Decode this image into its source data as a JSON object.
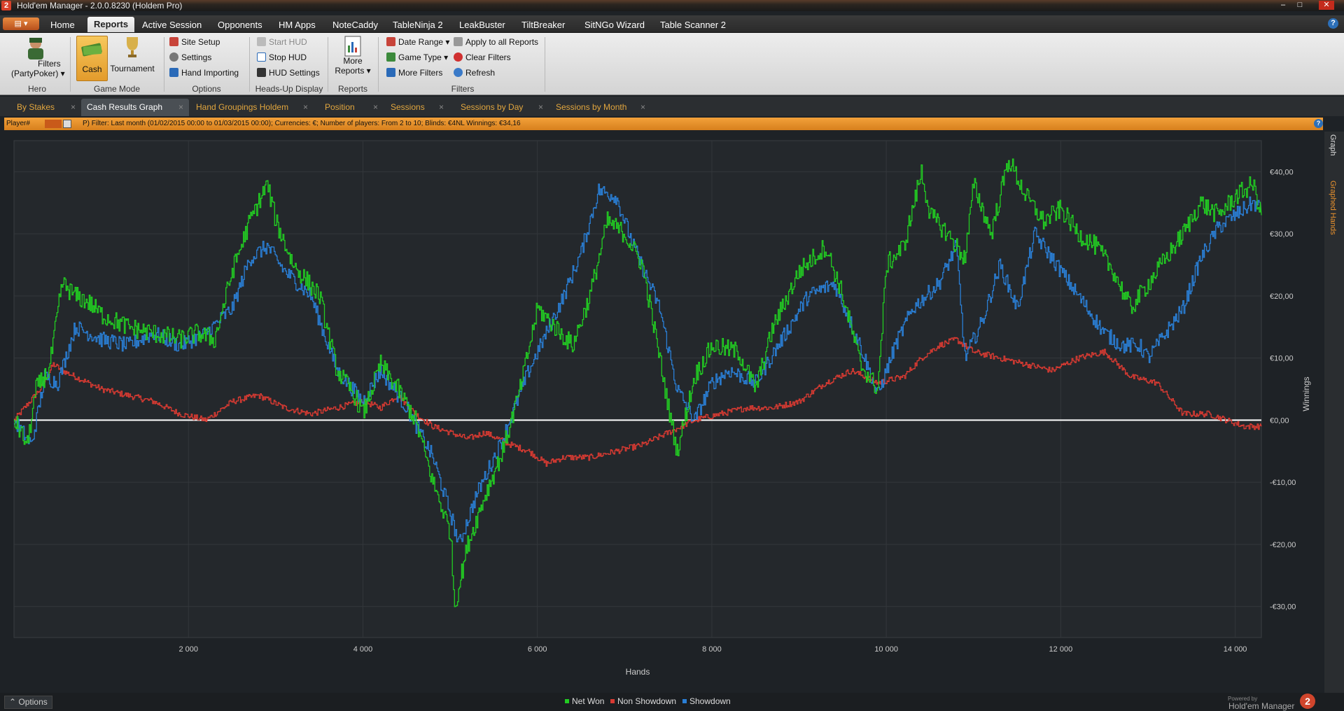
{
  "window": {
    "title": "Hold'em Manager - 2.0.0.8230 (Holdem Pro)",
    "app_badge": "2",
    "controls": [
      "–",
      "□",
      "✕"
    ]
  },
  "menu": {
    "items": [
      "Home",
      "Reports",
      "Active Session",
      "Opponents",
      "HM Apps",
      "NoteCaddy",
      "TableNinja 2",
      "LeakBuster",
      "TiltBreaker",
      "SitNGo Wizard",
      "Table Scanner 2"
    ],
    "active": "Reports",
    "help": "?"
  },
  "ribbon": {
    "hero": {
      "filters_label": "Filters",
      "site_label": "(PartyPoker) ▾",
      "group": "Hero"
    },
    "game_mode": {
      "cash": "Cash",
      "tournament": "Tournament",
      "group": "Game Mode"
    },
    "options": {
      "site_setup": "Site Setup",
      "settings": "Settings",
      "hand_importing": "Hand Importing",
      "group": "Options"
    },
    "hud": {
      "start": "Start HUD",
      "stop": "Stop HUD",
      "settings": "HUD Settings",
      "group": "Heads-Up Display"
    },
    "reports": {
      "more_line1": "More",
      "more_line2": "Reports ▾",
      "group": "Reports"
    },
    "filters": {
      "date_range": "Date Range ▾",
      "game_type": "Game Type ▾",
      "more_filters": "More Filters",
      "apply_all": "Apply to all Reports",
      "clear": "Clear Filters",
      "refresh": "Refresh",
      "group": "Filters"
    }
  },
  "tabs": [
    {
      "label": "By Stakes",
      "active": false
    },
    {
      "label": "Cash Results Graph",
      "active": true
    },
    {
      "label": "Hand Groupings Holdem",
      "active": false
    },
    {
      "label": "Position",
      "active": false
    },
    {
      "label": "Sessions",
      "active": false
    },
    {
      "label": "Sessions by Day",
      "active": false
    },
    {
      "label": "Sessions by Month",
      "active": false
    }
  ],
  "tab_close": "×",
  "filterbar": {
    "player_label": "Player#",
    "text": "P) Filter:  Last month (01/02/2015 00:00 to 01/03/2015 00:00); Currencies: €; Number of players: From 2 to 10; Blinds: €4NL  Winnings:  €34,16",
    "help": "?"
  },
  "side_tabs": {
    "graph": "Graph",
    "graphed_hands": "Graphed Hands"
  },
  "bottom": {
    "options": "Options",
    "powered_by": "Powered by",
    "brand": "Hold'em Manager",
    "brand_badge": "2"
  },
  "colors": {
    "net_won": "#22cc22",
    "non_showdown": "#d83a32",
    "showdown": "#2a7fd6",
    "accent": "#e8912e"
  },
  "chart_data": {
    "type": "line",
    "xlabel": "Hands",
    "ylabel": "Winnings",
    "x_ticks": [
      2000,
      4000,
      6000,
      8000,
      10000,
      12000,
      14000
    ],
    "x_tick_labels": [
      "2 000",
      "4 000",
      "6 000",
      "8 000",
      "10 000",
      "12 000",
      "14 000"
    ],
    "y_ticks": [
      -30,
      -20,
      -10,
      0,
      10,
      20,
      30,
      40
    ],
    "y_tick_labels": [
      "-€30,00",
      "-€20,00",
      "-€10,00",
      "€0,00",
      "€10,00",
      "€20,00",
      "€30,00",
      "€40,00"
    ],
    "xlim": [
      0,
      14300
    ],
    "ylim": [
      -35,
      45
    ],
    "grid": true,
    "legend": "bottom-center",
    "series": [
      {
        "name": "Net Won",
        "x": [
          0,
          150,
          250,
          400,
          550,
          700,
          850,
          1000,
          1300,
          1600,
          1900,
          2100,
          2300,
          2500,
          2700,
          2900,
          3000,
          3200,
          3500,
          3700,
          3900,
          4000,
          4200,
          4400,
          4600,
          4800,
          5000,
          5050,
          5200,
          5400,
          5600,
          5800,
          6000,
          6200,
          6400,
          6600,
          6800,
          7000,
          7200,
          7400,
          7500,
          7600,
          7800,
          8000,
          8300,
          8500,
          8700,
          9000,
          9300,
          9500,
          9700,
          9900,
          10000,
          10200,
          10400,
          10500,
          10700,
          10900,
          11000,
          11200,
          11400,
          11600,
          11800,
          12000,
          12200,
          12400,
          12600,
          12800,
          13000,
          13200,
          13400,
          13600,
          13800,
          14000,
          14200,
          14300
        ],
        "y": [
          0,
          -4,
          5,
          8,
          22,
          20,
          19,
          17,
          15,
          14,
          13,
          14,
          13,
          24,
          32,
          38,
          32,
          25,
          20,
          8,
          4,
          1,
          9,
          5,
          0,
          -10,
          -18,
          -30,
          -20,
          -12,
          -5,
          5,
          18,
          15,
          12,
          20,
          32,
          30,
          25,
          10,
          2,
          -5,
          7,
          12,
          11,
          5,
          15,
          24,
          28,
          20,
          9,
          5,
          25,
          28,
          40,
          33,
          30,
          26,
          38,
          30,
          42,
          36,
          32,
          34,
          30,
          28,
          24,
          18,
          22,
          26,
          30,
          35,
          33,
          36,
          38,
          33
        ]
      },
      {
        "name": "Non Showdown",
        "x": [
          0,
          300,
          450,
          550,
          700,
          1000,
          1300,
          1600,
          1900,
          2200,
          2500,
          2800,
          3100,
          3400,
          3700,
          4000,
          4200,
          4400,
          4600,
          4800,
          5000,
          5200,
          5400,
          5700,
          5900,
          6100,
          6300,
          6600,
          6900,
          7200,
          7500,
          7800,
          8100,
          8400,
          8700,
          9000,
          9300,
          9600,
          9900,
          10200,
          10400,
          10600,
          10800,
          11000,
          11300,
          11600,
          11900,
          12200,
          12500,
          12800,
          13100,
          13400,
          13700,
          13900,
          14100,
          14300
        ],
        "y": [
          0,
          5,
          9,
          8,
          7,
          5,
          4,
          3,
          1,
          0,
          3,
          4,
          2,
          1,
          2,
          3,
          2,
          4,
          1,
          -1,
          -2,
          -3,
          -2,
          -4,
          -5,
          -7,
          -6,
          -6,
          -5,
          -4,
          -2,
          0,
          1,
          2,
          2,
          3,
          6,
          8,
          6,
          7,
          10,
          12,
          13,
          11,
          10,
          9,
          8,
          10,
          11,
          7,
          6,
          1,
          1,
          0,
          -1,
          -1
        ]
      },
      {
        "name": "Showdown",
        "x": [
          0,
          200,
          350,
          500,
          700,
          1000,
          1300,
          1600,
          1900,
          2200,
          2500,
          2700,
          2900,
          3100,
          3400,
          3700,
          4000,
          4200,
          4500,
          4800,
          5000,
          5100,
          5300,
          5600,
          5900,
          6100,
          6300,
          6500,
          6700,
          6900,
          7100,
          7400,
          7600,
          7800,
          8000,
          8200,
          8500,
          8800,
          9100,
          9400,
          9700,
          9900,
          10100,
          10300,
          10600,
          10800,
          10900,
          11100,
          11300,
          11500,
          11700,
          11900,
          12100,
          12300,
          12500,
          12700,
          12900,
          13000,
          13200,
          13400,
          13600,
          13800,
          14000,
          14200,
          14300
        ],
        "y": [
          0,
          -4,
          7,
          6,
          15,
          13,
          12,
          14,
          12,
          14,
          18,
          26,
          28,
          24,
          20,
          8,
          3,
          8,
          2,
          -6,
          -15,
          -20,
          -12,
          -3,
          8,
          14,
          20,
          27,
          37,
          36,
          28,
          18,
          5,
          0,
          6,
          8,
          6,
          13,
          20,
          22,
          12,
          4,
          12,
          18,
          22,
          28,
          10,
          16,
          25,
          18,
          30,
          26,
          22,
          18,
          14,
          12,
          12,
          10,
          14,
          18,
          26,
          31,
          33,
          35,
          34
        ]
      }
    ]
  }
}
